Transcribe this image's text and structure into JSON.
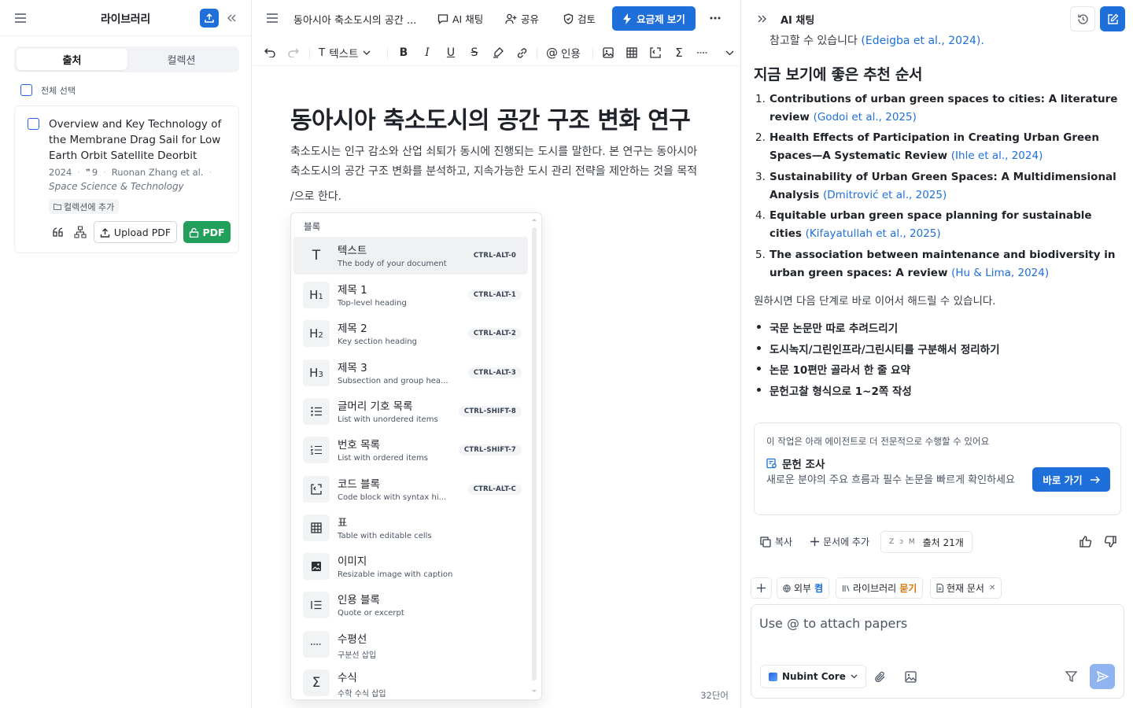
{
  "library": {
    "title": "라이브러리",
    "tabs": [
      {
        "label": "출처",
        "active": true
      },
      {
        "label": "컬렉션",
        "active": false
      }
    ],
    "select_all": "전체 선택",
    "paper": {
      "title": "Overview and Key Technology of the Membrane Drag Sail for Low Earth Orbit Satellite Deorbit",
      "year": "2024",
      "citations": "9",
      "authors": "Ruonan Zhang et al.",
      "journal": "Space Science & Technology",
      "add_collection": "컬렉션에 추가",
      "upload_pdf": "Upload PDF",
      "pdf": "PDF"
    }
  },
  "editor": {
    "tab_title": "동아시아 축소도시의 공간 ...",
    "toolbar": {
      "ai_chat": "AI 채팅",
      "share": "공유",
      "review": "검토",
      "upgrade": "요금제 보기",
      "text_style": "텍스트",
      "cite": "인용"
    },
    "heading": "동아시아 축소도시의 공간 구조 변화 연구",
    "body_line1": "축소도시는 인구 감소와 산업 쇠퇴가 동시에 진행되는 도시를 말한다. 본 연구는 동아시아",
    "body_line2": "축소도시의 공간 구조 변화를 분석하고, 지속가능한 도시 관리 전략을 제안하는 것을 목적",
    "body_line3": "/으로 한다.",
    "word_count": "32단어"
  },
  "block_menu": {
    "title": "블록",
    "items": [
      {
        "icon": "T",
        "label": "텍스트",
        "desc": "The body of your document",
        "shortcut": "CTRL-ALT-0",
        "active": true
      },
      {
        "icon": "H1",
        "label": "제목 1",
        "desc": "Top-level heading",
        "shortcut": "CTRL-ALT-1"
      },
      {
        "icon": "H2",
        "label": "제목 2",
        "desc": "Key section heading",
        "shortcut": "CTRL-ALT-2"
      },
      {
        "icon": "H3",
        "label": "제목 3",
        "desc": "Subsection and group hea...",
        "shortcut": "CTRL-ALT-3"
      },
      {
        "icon": "bullet-list-icon",
        "label": "글머리 기호 목록",
        "desc": "List with unordered items",
        "shortcut": "CTRL-SHIFT-8"
      },
      {
        "icon": "numbered-list-icon",
        "label": "번호 목록",
        "desc": "List with ordered items",
        "shortcut": "CTRL-SHIFT-7"
      },
      {
        "icon": "code-block-icon",
        "label": "코드 블록",
        "desc": "Code block with syntax hi...",
        "shortcut": "CTRL-ALT-C"
      },
      {
        "icon": "table-icon",
        "label": "표",
        "desc": "Table with editable cells",
        "shortcut": ""
      },
      {
        "icon": "image-icon",
        "label": "이미지",
        "desc": "Resizable image with caption",
        "shortcut": ""
      },
      {
        "icon": "quote-icon",
        "label": "인용 블록",
        "desc": "Quote or excerpt",
        "shortcut": ""
      },
      {
        "icon": "divider-icon",
        "label": "수평선",
        "desc": "구분선 삽입",
        "shortcut": ""
      },
      {
        "icon": "sigma-icon",
        "label": "수식",
        "desc": "수학 수식 삽입",
        "shortcut": ""
      }
    ]
  },
  "ai_panel": {
    "title": "AI 채팅",
    "cut_text": "참고할 수 있습니다",
    "cut_cite": "(Edeigba et al., 2024).",
    "rec_heading": "지금 보기에 좋은 추천 순서",
    "recommendations": [
      {
        "num": "1.",
        "title": "Contributions of urban green spaces to cities: A literature review",
        "cite": "(Godoi et al., 2025)"
      },
      {
        "num": "2.",
        "title": "Health Effects of Participation in Creating Urban Green Spaces—A Systematic Review",
        "cite": "(Ihle et al., 2024)"
      },
      {
        "num": "3.",
        "title": "Sustainability of Urban Green Spaces: A Multidimensional Analysis",
        "cite": "(Dmitrović et al., 2025)"
      },
      {
        "num": "4.",
        "title": "Equitable urban green space planning for sustainable cities",
        "cite": "(Kifayatullah et al., 2025)"
      },
      {
        "num": "5.",
        "title": "The association between maintenance and biodiversity in urban green spaces: A review",
        "cite": "(Hu & Lima, 2024)"
      }
    ],
    "next_intro": "원하시면 다음 단계로 바로 이어서 해드릴 수 있습니다.",
    "bullets": [
      "국문 논문만 따로 추려드리기",
      "도시녹지/그린인프라/그린시티를 구분해서 정리하기",
      "논문 10편만 골라서 한 줄 요약",
      "문헌고찰 형식으로 1~2쪽 작성"
    ],
    "agent_card": {
      "note": "이 작업은 아래 에이전트로 더 전문적으로 수행할 수 있어요",
      "name": "문헌 조사",
      "desc": "새로운 분야의 주요 흐름과 필수 논문을 빠르게 확인하세요",
      "go": "바로 가기"
    },
    "actions": {
      "copy": "복사",
      "add_to_doc": "문서에 추가",
      "source_favicons": "Z ↄ M",
      "sources": "출처 21개"
    },
    "context": {
      "external_label": "외부",
      "external_state": "켬",
      "library_label": "라이브러리",
      "library_state": "묻기",
      "current_doc": "현재 문서"
    },
    "composer": {
      "placeholder": "Use @ to attach papers",
      "model": "Nubint Core"
    }
  },
  "colors": {
    "accent": "#1e6fd9",
    "pdf_green": "#22a05b",
    "library_orange": "#d97706"
  }
}
